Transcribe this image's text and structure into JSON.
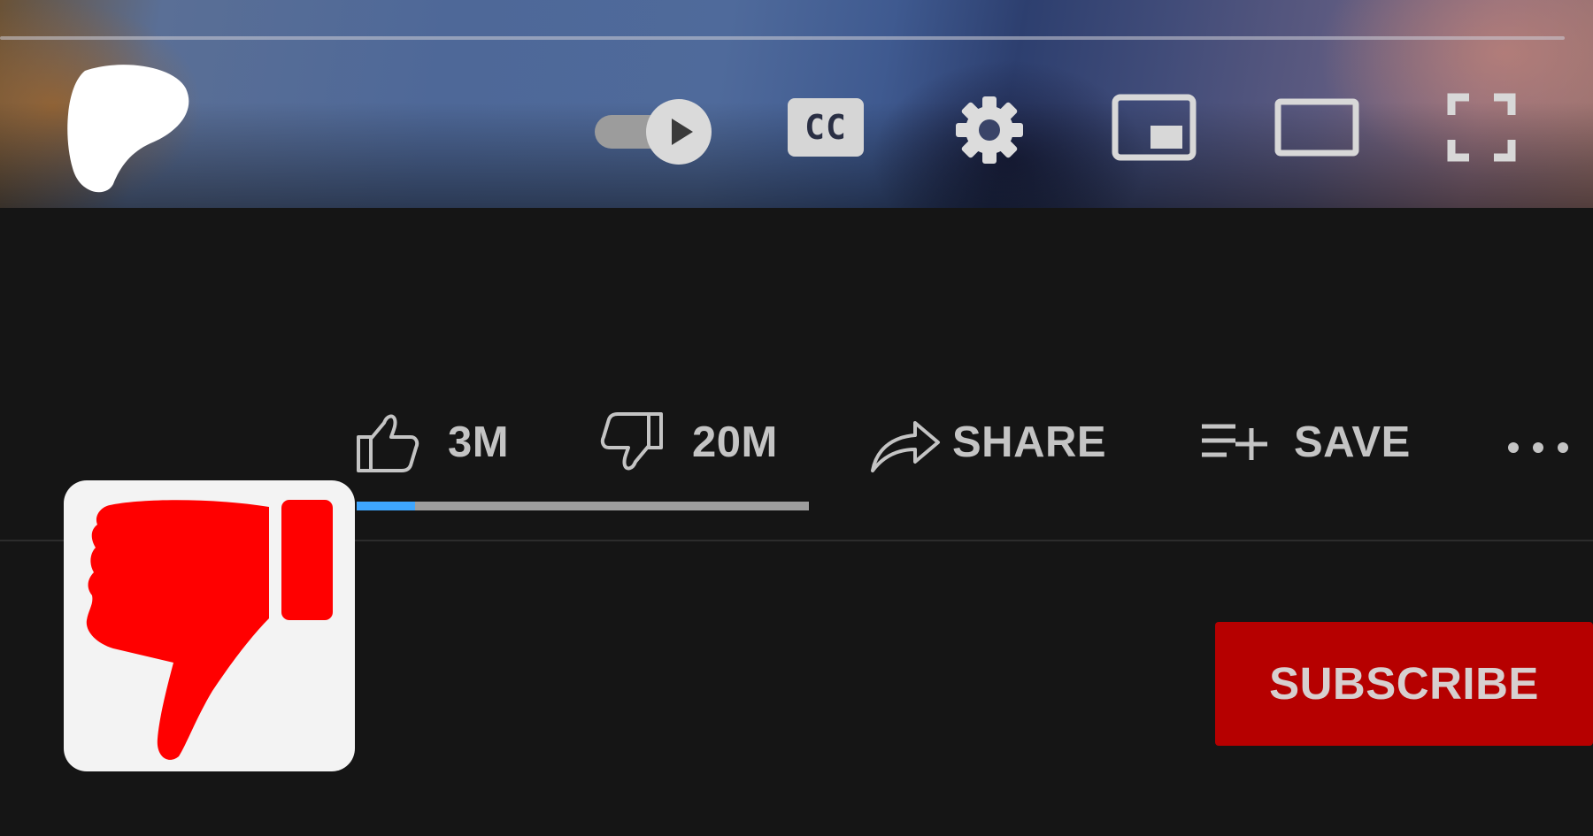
{
  "player": {
    "progress": 0.985,
    "autoplay_on": true,
    "captions_label": "CC"
  },
  "actions": {
    "like_count": "3M",
    "dislike_count": "20M",
    "share_label": "SHARE",
    "save_label": "SAVE",
    "more_label": "..."
  },
  "rating": {
    "like_fraction": 0.13
  },
  "subscribe": {
    "label": "SUBSCRIBE"
  },
  "colors": {
    "background": "#151515",
    "subscribe_bg": "#b60000",
    "like_bar": "#3ea6ff",
    "dislike_bar": "#9e9e9e",
    "dislike_logo": "#ff0000",
    "label_text": "#c4c4c4"
  },
  "icons": {
    "player_logo": "paint-blob-icon",
    "autoplay": "autoplay-toggle-icon",
    "captions": "cc-icon",
    "settings": "gear-icon",
    "miniplayer": "miniplayer-icon",
    "theater": "theater-mode-icon",
    "fullscreen": "fullscreen-icon",
    "like": "thumbs-up-icon",
    "dislike": "thumbs-down-icon",
    "share": "share-arrow-icon",
    "save": "playlist-add-icon",
    "more": "more-horizontal-icon",
    "extension": "thumbs-down-logo-icon"
  }
}
